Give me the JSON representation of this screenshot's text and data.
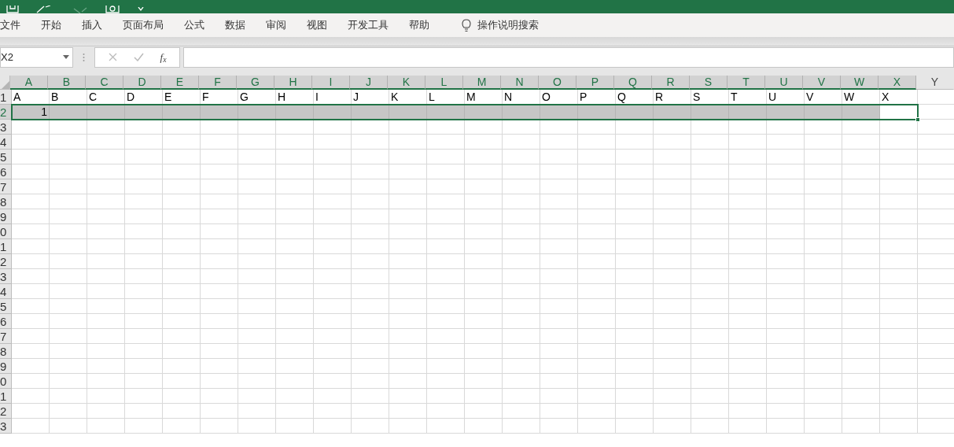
{
  "ribbon_tabs": [
    {
      "label": "文件",
      "selected": false
    },
    {
      "label": "开始",
      "selected": false
    },
    {
      "label": "插入",
      "selected": false
    },
    {
      "label": "页面布局",
      "selected": false
    },
    {
      "label": "公式",
      "selected": false
    },
    {
      "label": "数据",
      "selected": false
    },
    {
      "label": "审阅",
      "selected": false
    },
    {
      "label": "视图",
      "selected": false
    },
    {
      "label": "开发工具",
      "selected": false
    },
    {
      "label": "帮助",
      "selected": false
    }
  ],
  "tell_me": {
    "label": "操作说明搜索"
  },
  "name_box": {
    "value": "X2"
  },
  "formula_bar": {
    "function_label": "f$_{x}$"
  },
  "grid": {
    "columns": [
      {
        "label": "A",
        "selected": true,
        "active": false
      },
      {
        "label": "B",
        "selected": true,
        "active": false
      },
      {
        "label": "C",
        "selected": true,
        "active": false
      },
      {
        "label": "D",
        "selected": true,
        "active": false
      },
      {
        "label": "E",
        "selected": true,
        "active": false
      },
      {
        "label": "F",
        "selected": true,
        "active": false
      },
      {
        "label": "G",
        "selected": true,
        "active": false
      },
      {
        "label": "H",
        "selected": true,
        "active": false
      },
      {
        "label": "I",
        "selected": true,
        "active": false
      },
      {
        "label": "J",
        "selected": true,
        "active": false
      },
      {
        "label": "K",
        "selected": true,
        "active": false
      },
      {
        "label": "L",
        "selected": true,
        "active": false
      },
      {
        "label": "M",
        "selected": true,
        "active": false
      },
      {
        "label": "N",
        "selected": true,
        "active": false
      },
      {
        "label": "O",
        "selected": true,
        "active": false
      },
      {
        "label": "P",
        "selected": true,
        "active": false
      },
      {
        "label": "Q",
        "selected": true,
        "active": false
      },
      {
        "label": "R",
        "selected": true,
        "active": false
      },
      {
        "label": "S",
        "selected": true,
        "active": false
      },
      {
        "label": "T",
        "selected": true,
        "active": false
      },
      {
        "label": "U",
        "selected": true,
        "active": false
      },
      {
        "label": "V",
        "selected": true,
        "active": false
      },
      {
        "label": "W",
        "selected": true,
        "active": false
      },
      {
        "label": "X",
        "selected": true,
        "active": true
      },
      {
        "label": "Y",
        "selected": false,
        "active": false
      }
    ],
    "rows": [
      {
        "label": "1",
        "selected": false,
        "cells": [
          "A",
          "B",
          "C",
          "D",
          "E",
          "F",
          "G",
          "H",
          "I",
          "J",
          "K",
          "L",
          "M",
          "N",
          "O",
          "P",
          "Q",
          "R",
          "S",
          "T",
          "U",
          "V",
          "W",
          "X"
        ]
      },
      {
        "label": "2",
        "selected": true,
        "cells": [
          "1"
        ]
      },
      {
        "label": "3",
        "selected": false
      },
      {
        "label": "4",
        "selected": false
      },
      {
        "label": "5",
        "selected": false
      },
      {
        "label": "6",
        "selected": false
      },
      {
        "label": "7",
        "selected": false
      },
      {
        "label": "8",
        "selected": false
      },
      {
        "label": "9",
        "selected": false
      },
      {
        "label": "0",
        "selected": false
      },
      {
        "label": "1",
        "selected": false
      },
      {
        "label": "2",
        "selected": false
      },
      {
        "label": "3",
        "selected": false
      },
      {
        "label": "4",
        "selected": false
      },
      {
        "label": "5",
        "selected": false
      },
      {
        "label": "6",
        "selected": false
      },
      {
        "label": "7",
        "selected": false
      },
      {
        "label": "8",
        "selected": false
      },
      {
        "label": "9",
        "selected": false
      },
      {
        "label": "0",
        "selected": false
      },
      {
        "label": "1",
        "selected": false
      },
      {
        "label": "2",
        "selected": false
      },
      {
        "label": "3",
        "selected": false
      }
    ]
  }
}
